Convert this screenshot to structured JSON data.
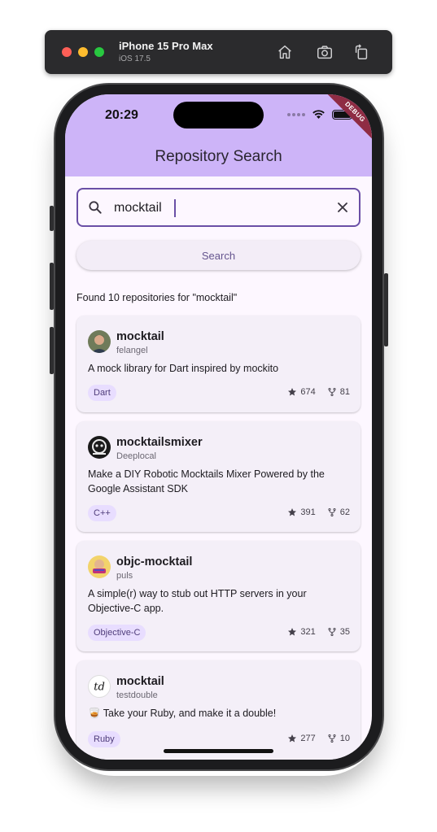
{
  "simulator": {
    "device_name": "iPhone 15 Pro Max",
    "os_version": "iOS 17.5",
    "home_icon": "home-icon",
    "screenshot_icon": "camera-icon",
    "rotate_icon": "rotate-icon"
  },
  "status_bar": {
    "time": "20:29",
    "debug_banner": "DEBUG"
  },
  "app_bar": {
    "title": "Repository Search"
  },
  "search": {
    "value": "mocktail",
    "placeholder": "",
    "button_label": "Search"
  },
  "results": {
    "summary": "Found 10 repositories for \"mocktail\""
  },
  "repositories": [
    {
      "name": "mocktail",
      "owner": "felangel",
      "description": "A mock library for Dart inspired by mockito",
      "language": "Dart",
      "stars": "674",
      "forks": "81"
    },
    {
      "name": "mocktailsmixer",
      "owner": "Deeplocal",
      "description": "Make a DIY Robotic Mocktails Mixer Powered by the Google Assistant SDK",
      "language": "C++",
      "stars": "391",
      "forks": "62"
    },
    {
      "name": "objc-mocktail",
      "owner": "puls",
      "description": "A simple(r) way to stub out HTTP servers in your Objective-C app.",
      "language": "Objective-C",
      "stars": "321",
      "forks": "35"
    },
    {
      "name": "mocktail",
      "owner": "testdouble",
      "description": "🥃 Take your Ruby, and make it a double!",
      "language": "Ruby",
      "stars": "277",
      "forks": "10"
    }
  ],
  "colors": {
    "app_bar": "#cdb4f8",
    "background": "#fdf7ff",
    "accent": "#6a4fa6",
    "chip": "#e8ddff",
    "card": "#f4eff8"
  }
}
